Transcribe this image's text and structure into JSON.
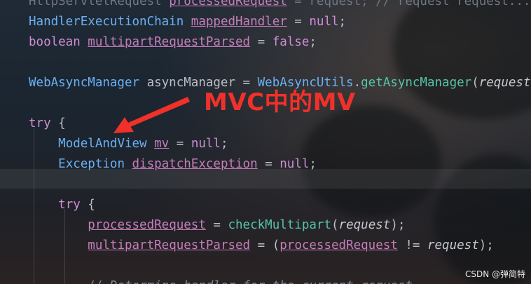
{
  "editor": {
    "lines": [
      [
        {
          "t": "HttpServletRequest ",
          "c": "dim"
        },
        {
          "t": "processedRequest",
          "c": "fld"
        },
        {
          "t": " = request; // request request...",
          "c": "dim"
        }
      ],
      [
        {
          "t": "HandlerExecutionChain ",
          "c": "type"
        },
        {
          "t": "mappedHandler",
          "c": "fld"
        },
        {
          "t": " = ",
          "c": "plain"
        },
        {
          "t": "null",
          "c": "kw"
        },
        {
          "t": ";",
          "c": "plain"
        }
      ],
      [
        {
          "t": "boolean ",
          "c": "kw"
        },
        {
          "t": "multipartRequestParsed",
          "c": "fld"
        },
        {
          "t": " = ",
          "c": "plain"
        },
        {
          "t": "false",
          "c": "kw"
        },
        {
          "t": ";",
          "c": "plain"
        }
      ],
      [],
      [
        {
          "t": "WebAsyncManager ",
          "c": "type"
        },
        {
          "t": "asyncManager = ",
          "c": "plain"
        },
        {
          "t": "WebAsyncUtils",
          "c": "type"
        },
        {
          "t": ".",
          "c": "plain"
        },
        {
          "t": "getAsyncManager",
          "c": "fn"
        },
        {
          "t": "(",
          "c": "plain"
        },
        {
          "t": "request",
          "c": "param"
        }
      ],
      [],
      [
        {
          "t": "try",
          "c": "kw"
        },
        {
          "t": " {",
          "c": "plain"
        }
      ],
      [
        {
          "t": "    "
        },
        {
          "t": "ModelAndView ",
          "c": "type"
        },
        {
          "t": "mv",
          "c": "fld"
        },
        {
          "t": " = ",
          "c": "plain"
        },
        {
          "t": "null",
          "c": "kw"
        },
        {
          "t": ";",
          "c": "plain"
        }
      ],
      [
        {
          "t": "    "
        },
        {
          "t": "Exception ",
          "c": "type"
        },
        {
          "t": "dispatchException",
          "c": "fld"
        },
        {
          "t": " = ",
          "c": "plain"
        },
        {
          "t": "null",
          "c": "kw"
        },
        {
          "t": ";",
          "c": "plain"
        }
      ],
      [],
      [
        {
          "t": "    "
        },
        {
          "t": "try",
          "c": "kw"
        },
        {
          "t": " {",
          "c": "plain"
        }
      ],
      [
        {
          "t": "        "
        },
        {
          "t": "processedRequest",
          "c": "fld"
        },
        {
          "t": " = ",
          "c": "plain"
        },
        {
          "t": "checkMultipart",
          "c": "fn"
        },
        {
          "t": "(",
          "c": "plain"
        },
        {
          "t": "request",
          "c": "param"
        },
        {
          "t": ");",
          "c": "plain"
        }
      ],
      [
        {
          "t": "        "
        },
        {
          "t": "multipartRequestParsed",
          "c": "fld"
        },
        {
          "t": " = (",
          "c": "plain"
        },
        {
          "t": "processedRequest",
          "c": "fld"
        },
        {
          "t": " != ",
          "c": "plain"
        },
        {
          "t": "request",
          "c": "param"
        },
        {
          "t": ");",
          "c": "plain"
        }
      ],
      [],
      [
        {
          "t": "        // Determine handler for the current request.",
          "c": "comment"
        }
      ]
    ]
  },
  "annotation": {
    "text": "MVC中的MV",
    "color": "#f0312a"
  },
  "watermark": "CSDN @弹简特"
}
